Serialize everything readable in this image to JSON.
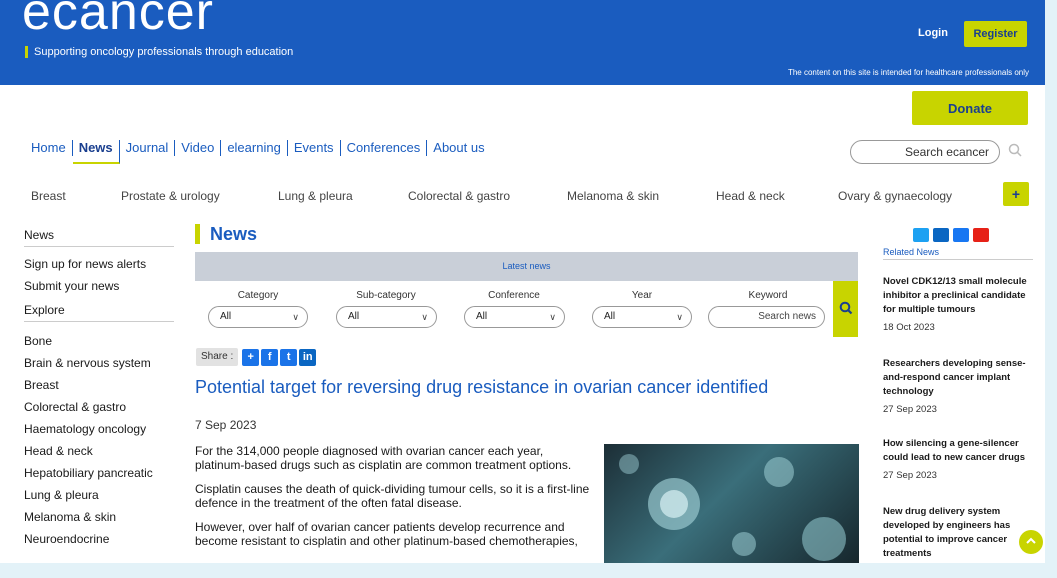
{
  "header": {
    "logo": "ecancer",
    "tagline": "Supporting oncology professionals through education",
    "login": "Login",
    "register": "Register",
    "notice": "The content on this site is intended for healthcare professionals only",
    "donate": "Donate",
    "accent": "#c8d400",
    "brand": "#1a5cbf"
  },
  "nav": {
    "items": [
      "Home",
      "News",
      "Journal",
      "Video",
      "elearning",
      "Events",
      "Conferences",
      "About us"
    ],
    "active": "News",
    "search_placeholder": "Search ecancer"
  },
  "categories": [
    "Breast",
    "Prostate & urology",
    "Lung & pleura",
    "Colorectal & gastro",
    "Melanoma & skin",
    "Head & neck",
    "Ovary & gynaecology"
  ],
  "more_label": "+",
  "sidebar": {
    "heading": "News",
    "links": [
      "Sign up for news alerts",
      "Submit your news"
    ],
    "explore": "Explore",
    "topics": [
      "Bone",
      "Brain & nervous system",
      "Breast",
      "Colorectal & gastro",
      "Haematology oncology",
      "Head & neck",
      "Hepatobiliary pancreatic",
      "Lung & pleura",
      "Melanoma & skin",
      "Neuroendocrine"
    ]
  },
  "main": {
    "title": "News",
    "latest_label": "Latest news",
    "filters": [
      {
        "label": "Category",
        "value": "All"
      },
      {
        "label": "Sub-category",
        "value": "All"
      },
      {
        "label": "Conference",
        "value": "All"
      },
      {
        "label": "Year",
        "value": "All"
      }
    ],
    "keyword_label": "Keyword",
    "keyword_placeholder": "Search news",
    "share_label": "Share :",
    "article": {
      "title": "Potential target for reversing drug resistance in ovarian cancer identified",
      "date": "7 Sep 2023",
      "paragraphs": [
        "For the 314,000 people diagnosed with ovarian cancer each year, platinum-based drugs such as cisplatin are common treatment options.",
        "Cisplatin causes the death of quick-dividing tumour cells, so it is a first-line defence in the treatment of the often fatal disease.",
        "However, over half of ovarian cancer patients develop recurrence and become resistant to cisplatin and other platinum-based chemotherapies,"
      ]
    }
  },
  "related": {
    "heading": "Related News",
    "items": [
      {
        "title": "Novel CDK12/13 small molecule inhibitor a preclinical candidate for multiple tumours",
        "date": "18 Oct 2023"
      },
      {
        "title": "Researchers developing sense-and-respond cancer implant technology",
        "date": "27 Sep 2023"
      },
      {
        "title": "How silencing a gene-silencer could lead to new cancer drugs",
        "date": "27 Sep 2023"
      },
      {
        "title": "New drug delivery system developed by engineers has potential to improve cancer treatments",
        "date": ""
      }
    ]
  }
}
